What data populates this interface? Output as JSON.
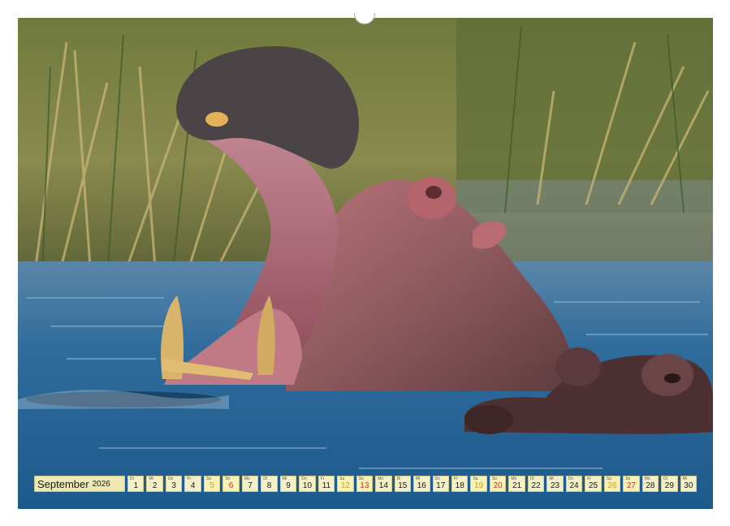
{
  "calendar": {
    "month": "September",
    "year": "2026",
    "days": [
      {
        "weekday": "Di",
        "day": "1",
        "type": "weekday"
      },
      {
        "weekday": "Mi",
        "day": "2",
        "type": "weekday"
      },
      {
        "weekday": "Do",
        "day": "3",
        "type": "weekday"
      },
      {
        "weekday": "Fr",
        "day": "4",
        "type": "weekday"
      },
      {
        "weekday": "Sa",
        "day": "5",
        "type": "saturday"
      },
      {
        "weekday": "So",
        "day": "6",
        "type": "sunday"
      },
      {
        "weekday": "Mo",
        "day": "7",
        "type": "weekday"
      },
      {
        "weekday": "Di",
        "day": "8",
        "type": "weekday"
      },
      {
        "weekday": "Mi",
        "day": "9",
        "type": "weekday"
      },
      {
        "weekday": "Do",
        "day": "10",
        "type": "weekday"
      },
      {
        "weekday": "Fr",
        "day": "11",
        "type": "weekday"
      },
      {
        "weekday": "Sa",
        "day": "12",
        "type": "saturday"
      },
      {
        "weekday": "So",
        "day": "13",
        "type": "sunday"
      },
      {
        "weekday": "Mo",
        "day": "14",
        "type": "weekday"
      },
      {
        "weekday": "Di",
        "day": "15",
        "type": "weekday"
      },
      {
        "weekday": "Mi",
        "day": "16",
        "type": "weekday"
      },
      {
        "weekday": "Do",
        "day": "17",
        "type": "weekday"
      },
      {
        "weekday": "Fr",
        "day": "18",
        "type": "weekday"
      },
      {
        "weekday": "Sa",
        "day": "19",
        "type": "saturday"
      },
      {
        "weekday": "So",
        "day": "20",
        "type": "sunday"
      },
      {
        "weekday": "Mo",
        "day": "21",
        "type": "weekday"
      },
      {
        "weekday": "Di",
        "day": "22",
        "type": "weekday"
      },
      {
        "weekday": "Mi",
        "day": "23",
        "type": "weekday"
      },
      {
        "weekday": "Do",
        "day": "24",
        "type": "weekday"
      },
      {
        "weekday": "Fr",
        "day": "25",
        "type": "weekday"
      },
      {
        "weekday": "Sa",
        "day": "26",
        "type": "saturday"
      },
      {
        "weekday": "So",
        "day": "27",
        "type": "sunday"
      },
      {
        "weekday": "Mo",
        "day": "28",
        "type": "weekday"
      },
      {
        "weekday": "Di",
        "day": "29",
        "type": "weekday"
      },
      {
        "weekday": "Mi",
        "day": "30",
        "type": "weekday"
      }
    ]
  },
  "photo": {
    "subject": "hippo-yawning-photo"
  },
  "colors": {
    "saturday": "#c8a027",
    "sunday": "#c0392b",
    "strip_background": "#f3efc6"
  }
}
